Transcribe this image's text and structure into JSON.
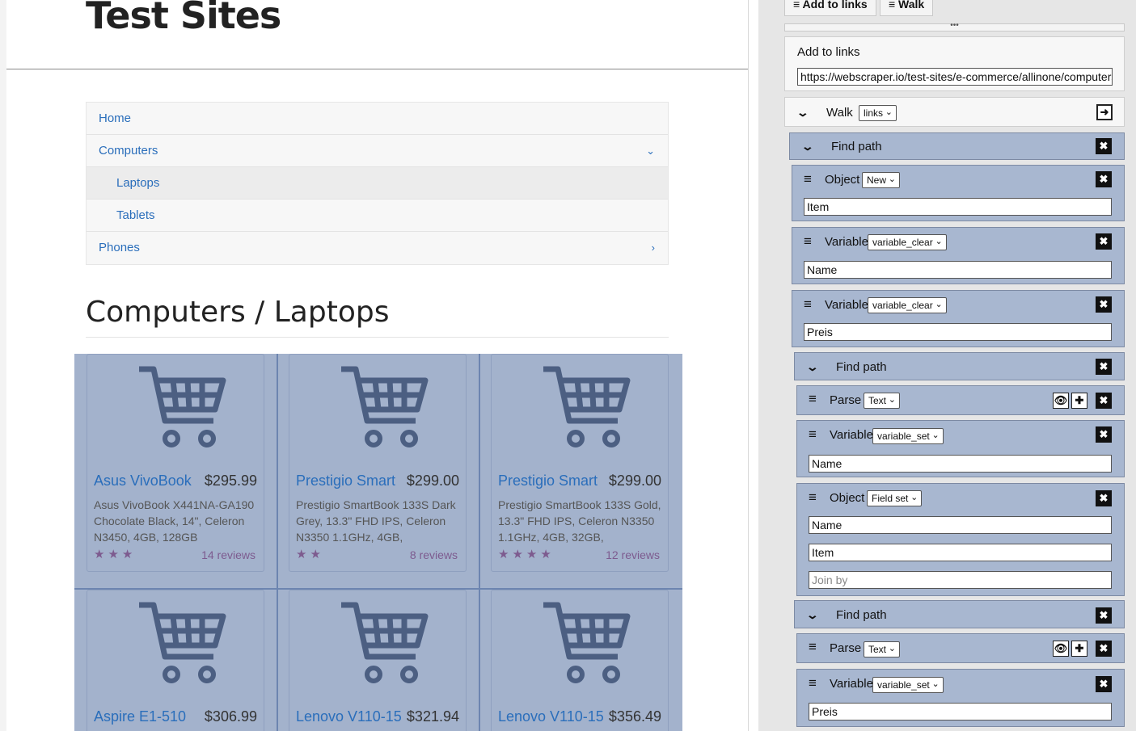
{
  "site": {
    "title": "Test Sites",
    "nav": [
      {
        "label": "Home"
      },
      {
        "label": "Computers",
        "chevron": "⌄"
      },
      {
        "label": "Laptops"
      },
      {
        "label": "Tablets"
      },
      {
        "label": "Phones",
        "chevron": "›"
      }
    ],
    "category_title": "Computers / Laptops",
    "products": [
      {
        "name": "Asus VivoBook",
        "price": "$295.99",
        "description": "Asus VivoBook X441NA-GA190 Chocolate Black, 14\", Celeron N3450, 4GB, 128GB",
        "stars": "★★★",
        "reviews": "14 reviews"
      },
      {
        "name": "Prestigio Smart",
        "price": "$299.00",
        "description": "Prestigio SmartBook 133S Dark Grey, 13.3\" FHD IPS, Celeron N3350 1.1GHz, 4GB,",
        "stars": "★★",
        "reviews": "8 reviews"
      },
      {
        "name": "Prestigio Smart",
        "price": "$299.00",
        "description": "Prestigio SmartBook 133S Gold, 13.3\" FHD IPS, Celeron N3350 1.1GHz, 4GB, 32GB,",
        "stars": "★★★★",
        "reviews": "12 reviews"
      },
      {
        "name": "Aspire E1-510",
        "price": "$306.99"
      },
      {
        "name": "Lenovo V110-15",
        "price": "$321.94"
      },
      {
        "name": "Lenovo V110-15",
        "price": "$356.49"
      }
    ]
  },
  "panel": {
    "tabs": [
      "≡ Add to links",
      "≡ Walk"
    ],
    "splitter": "•••",
    "add_to_links": {
      "label": "Add to links",
      "url": "https://webscraper.io/test-sites/e-commerce/allinone/computers"
    },
    "walk": {
      "label": "Walk",
      "select": "links",
      "go": "➜"
    },
    "find_path_1": {
      "label": "Find path",
      "close": "✖"
    },
    "object_1": {
      "label": "Object",
      "select": "New",
      "value": "Item"
    },
    "variable_1": {
      "label": "Variable",
      "select": "variable_clear",
      "value": "Name"
    },
    "variable_2": {
      "label": "Variable",
      "select": "variable_clear",
      "value": "Preis"
    },
    "find_path_2": {
      "label": "Find path"
    },
    "parse_1": {
      "label": "Parse",
      "select": "Text"
    },
    "variable_3": {
      "label": "Variable",
      "select": "variable_set",
      "value": "Name"
    },
    "object_2": {
      "label": "Object",
      "select": "Field set",
      "value1": "Name",
      "value2": "Item",
      "placeholder": "Join by"
    },
    "find_path_3": {
      "label": "Find path"
    },
    "parse_2": {
      "label": "Parse",
      "select": "Text"
    },
    "variable_4": {
      "label": "Variable",
      "select": "variable_set",
      "value": "Preis"
    },
    "icons": {
      "eye": "👁",
      "plus": "✚",
      "close": "✖",
      "hamburger": "≡",
      "chevron": "⌄",
      "caret": "⌄"
    }
  },
  "colors": {
    "link": "#2a6ebb",
    "highlight": "#a3b2cc",
    "panel_block": "#a8b7d0",
    "stars": "#7d5b8f"
  }
}
